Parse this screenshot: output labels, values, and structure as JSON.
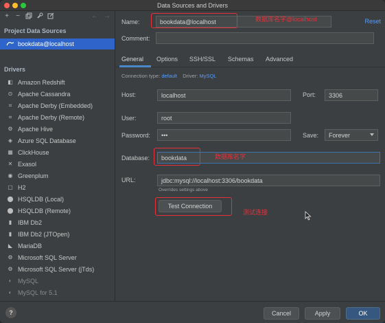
{
  "window": {
    "title": "Data Sources and Drivers"
  },
  "left_toolbar": {
    "icons": [
      "add-icon",
      "remove-icon",
      "duplicate-icon",
      "wrench-icon",
      "edit-icon",
      "back-icon",
      "forward-icon"
    ]
  },
  "project": {
    "section_title": "Project Data Sources",
    "items": [
      {
        "label": "bookdata@localhost"
      }
    ]
  },
  "drivers": {
    "section_title": "Drivers",
    "items": [
      {
        "label": "Amazon Redshift"
      },
      {
        "label": "Apache Cassandra"
      },
      {
        "label": "Apache Derby (Embedded)"
      },
      {
        "label": "Apache Derby (Remote)"
      },
      {
        "label": "Apache Hive"
      },
      {
        "label": "Azure SQL Database"
      },
      {
        "label": "ClickHouse"
      },
      {
        "label": "Exasol"
      },
      {
        "label": "Greenplum"
      },
      {
        "label": "H2"
      },
      {
        "label": "HSQLDB (Local)"
      },
      {
        "label": "HSQLDB (Remote)"
      },
      {
        "label": "IBM Db2"
      },
      {
        "label": "IBM Db2 (JTOpen)"
      },
      {
        "label": "MariaDB"
      },
      {
        "label": "Microsoft SQL Server"
      },
      {
        "label": "Microsoft SQL Server (jTds)"
      },
      {
        "label": "MySQL"
      },
      {
        "label": "MySQL for 5.1"
      }
    ]
  },
  "form": {
    "name_label": "Name:",
    "name_value": "bookdata@localhost",
    "reset_label": "Reset",
    "comment_label": "Comment:",
    "comment_value": "",
    "tabs": [
      "General",
      "Options",
      "SSH/SSL",
      "Schemas",
      "Advanced"
    ],
    "connection_type_label": "Connection type:",
    "connection_type_value": "default",
    "driver_label": "Driver:",
    "driver_value": "MySQL",
    "host_label": "Host:",
    "host_value": "localhost",
    "port_label": "Port:",
    "port_value": "3306",
    "user_label": "User:",
    "user_value": "root",
    "password_label": "Password:",
    "password_value": "•••",
    "save_label": "Save:",
    "save_value": "Forever",
    "database_label": "Database:",
    "database_value": "bookdata",
    "url_label": "URL:",
    "url_value": "jdbc:mysql://localhost:3306/bookdata",
    "url_hint": "Overrides settings above",
    "test_button": "Test Connection"
  },
  "annotations": {
    "name_note": "数据库名字@localhost",
    "database_note": "数据库名字",
    "test_note": "测试连接"
  },
  "footer": {
    "help": "?",
    "cancel": "Cancel",
    "apply": "Apply",
    "ok": "OK"
  },
  "colors": {
    "accent": "#2f65ca",
    "link": "#589df6",
    "annotation_red": "#e8303a",
    "primary_button": "#365880"
  }
}
